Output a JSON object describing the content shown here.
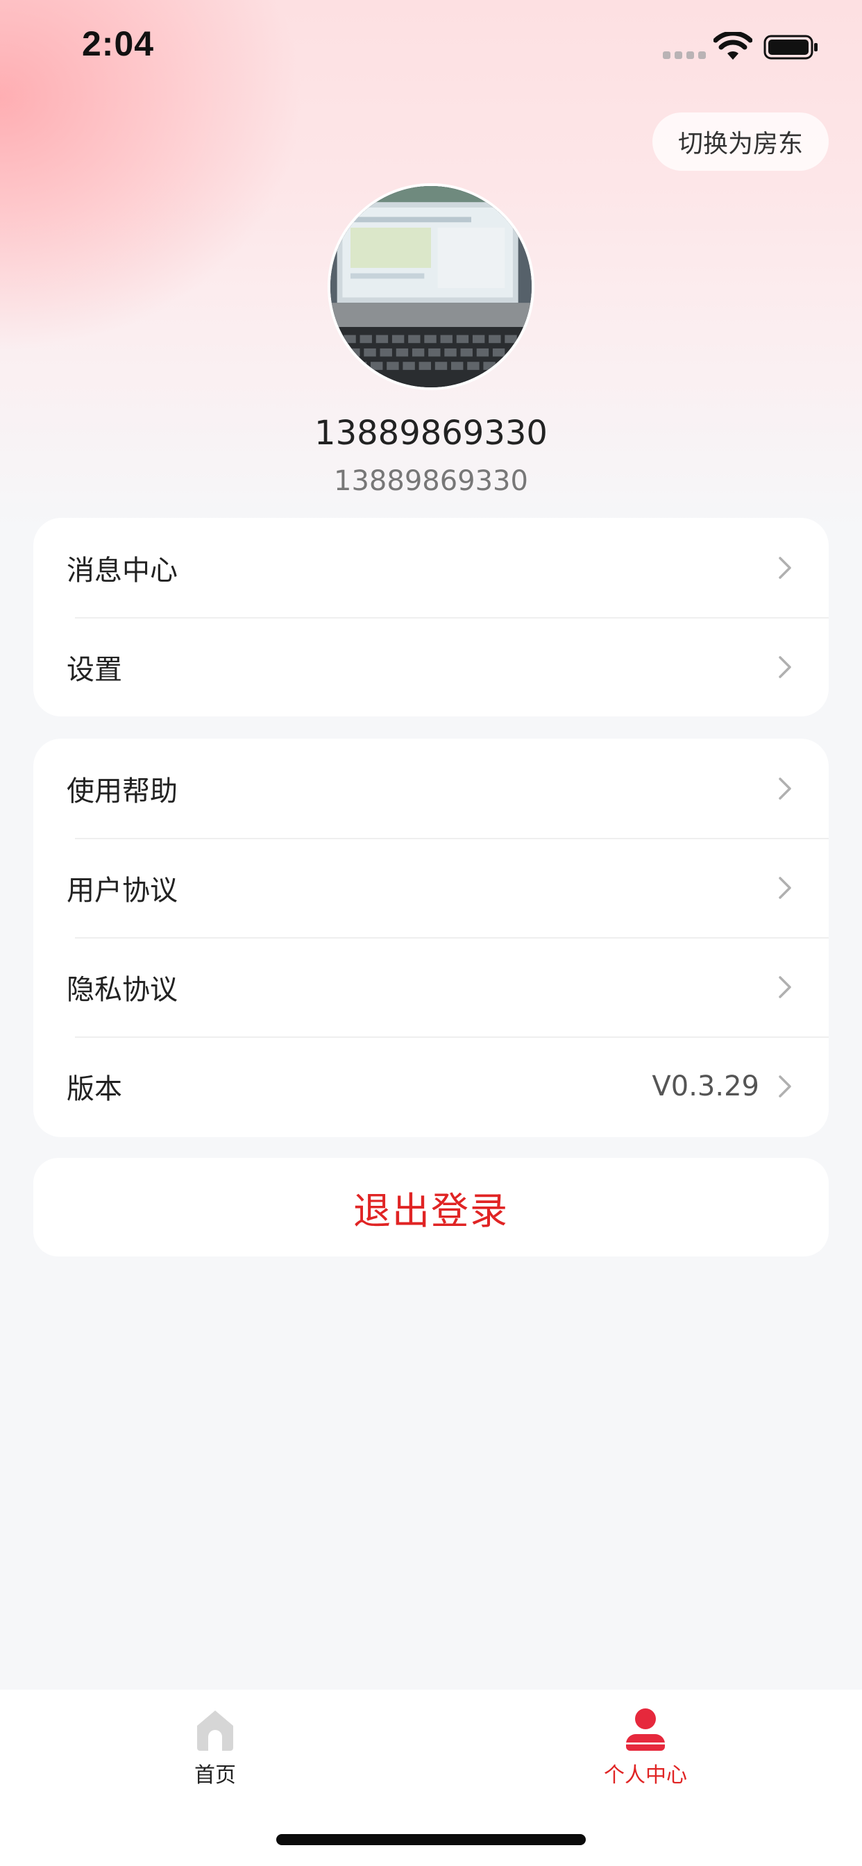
{
  "status_bar": {
    "time": "2:04"
  },
  "header": {
    "switch_role_label": "切换为房东"
  },
  "profile": {
    "name": "13889869330",
    "phone": "13889869330"
  },
  "menu_group_1": [
    {
      "label": "消息中心"
    },
    {
      "label": "设置"
    }
  ],
  "menu_group_2": [
    {
      "label": "使用帮助"
    },
    {
      "label": "用户协议"
    },
    {
      "label": "隐私协议"
    },
    {
      "label": "版本",
      "value": "V0.3.29"
    }
  ],
  "logout_label": "退出登录",
  "tab_bar": {
    "items": [
      {
        "label": "首页",
        "icon": "home-icon",
        "active": false
      },
      {
        "label": "个人中心",
        "icon": "user-icon",
        "active": true
      }
    ]
  },
  "colors": {
    "accent": "#e02424",
    "background": "#f6f7f9",
    "header_tint": "#fde0e2"
  }
}
